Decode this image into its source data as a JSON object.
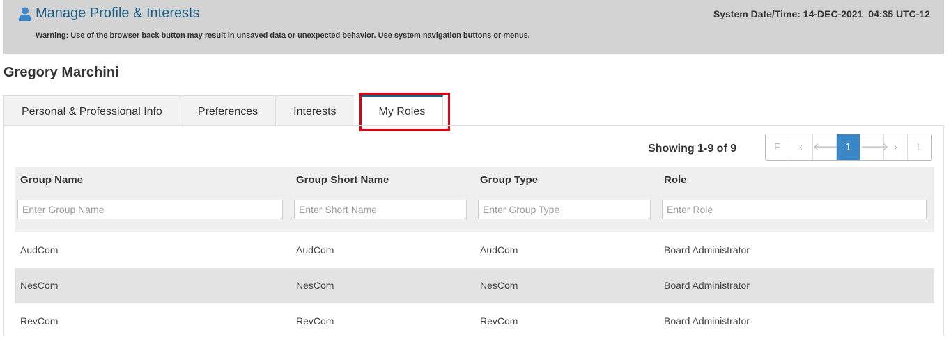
{
  "header": {
    "title": "Manage Profile & Interests",
    "warning": "Warning: Use of the browser back button may result in unsaved data or unexpected behavior. Use system navigation buttons or menus.",
    "system_label": "System Date/Time: 14-DEC-2021",
    "system_time": "04:35 UTC-12"
  },
  "user_name": "Gregory Marchini",
  "tabs": [
    {
      "label": "Personal & Professional Info"
    },
    {
      "label": "Preferences"
    },
    {
      "label": "Interests"
    },
    {
      "label": "My Roles"
    }
  ],
  "active_tab": "My Roles",
  "pagination": {
    "showing": "Showing 1-9 of 9",
    "first": "F",
    "prev": "‹",
    "prev_arrow": "🡐",
    "current": "1",
    "next_arrow": "🡒",
    "next": "›",
    "last": "L"
  },
  "table": {
    "columns": [
      "Group Name",
      "Group Short Name",
      "Group Type",
      "Role"
    ],
    "filters": [
      "Enter Group Name",
      "Enter Short Name",
      "Enter Group Type",
      "Enter Role"
    ],
    "rows": [
      [
        "AudCom",
        "AudCom",
        "AudCom",
        "Board Administrator"
      ],
      [
        "NesCom",
        "NesCom",
        "NesCom",
        "Board Administrator"
      ],
      [
        "RevCom",
        "RevCom",
        "RevCom",
        "Board Administrator"
      ]
    ]
  },
  "colors": {
    "accent": "#1a5f86",
    "highlight": "#e3000f",
    "page_current": "#3a87c8"
  }
}
